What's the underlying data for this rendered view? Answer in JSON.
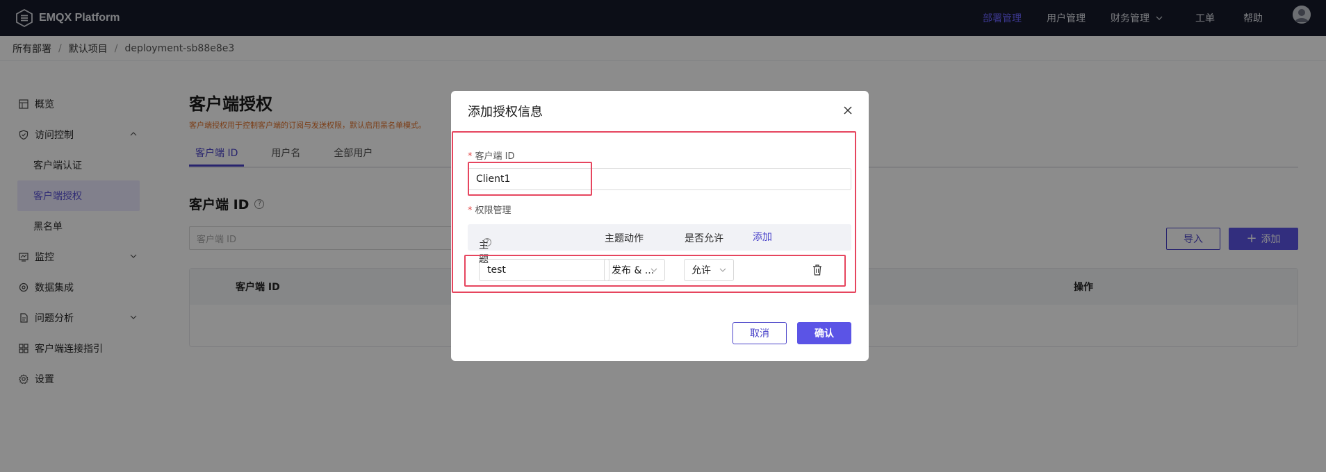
{
  "app": {
    "title": "EMQX Platform"
  },
  "topnav": {
    "items": [
      {
        "label": "部署管理",
        "active": true
      },
      {
        "label": "用户管理"
      },
      {
        "label": "财务管理",
        "has_dropdown": true
      },
      {
        "label": "工单"
      },
      {
        "label": "帮助"
      }
    ]
  },
  "breadcrumb": [
    "所有部署",
    "默认项目",
    "deployment-sb88e8e3"
  ],
  "sidebar": {
    "items": [
      {
        "label": "概览",
        "icon": "overview-icon"
      },
      {
        "label": "访问控制",
        "icon": "shield-icon",
        "expanded": true
      },
      {
        "label": "客户端认证",
        "sub": true
      },
      {
        "label": "客户端授权",
        "sub": true,
        "active": true
      },
      {
        "label": "黑名单",
        "sub": true
      },
      {
        "label": "监控",
        "icon": "monitor-icon",
        "expandable": true
      },
      {
        "label": "数据集成",
        "icon": "integration-icon"
      },
      {
        "label": "问题分析",
        "icon": "analysis-icon",
        "expandable": true
      },
      {
        "label": "客户端连接指引",
        "icon": "guide-icon"
      },
      {
        "label": "设置",
        "icon": "gear-icon"
      }
    ]
  },
  "main": {
    "title": "客户端授权",
    "description": "客户端授权用于控制客户端的订阅与发送权限，默认启用黑名单模式。",
    "tabs": [
      {
        "label": "客户端 ID",
        "active": true
      },
      {
        "label": "用户名"
      },
      {
        "label": "全部用户"
      }
    ],
    "section_title": "客户端 ID",
    "search_placeholder": "客户端 ID",
    "import_label": "导入",
    "add_label": "添加",
    "table_headers": [
      "客户端 ID",
      "操作"
    ]
  },
  "modal": {
    "title": "添加授权信息",
    "client_id_label": "客户端 ID",
    "client_id_value": "Client1",
    "perm_label": "权限管理",
    "perm_headers": {
      "topic": "主题",
      "action": "主题动作",
      "allow": "是否允许",
      "add": "添加"
    },
    "rows": [
      {
        "topic": "test",
        "action": "发布 & ...",
        "allow": "允许"
      }
    ],
    "cancel_label": "取消",
    "confirm_label": "确认"
  },
  "colors": {
    "accent": "#5b54e6",
    "annotation": "#e6455e",
    "topbar": "#171b2a"
  }
}
